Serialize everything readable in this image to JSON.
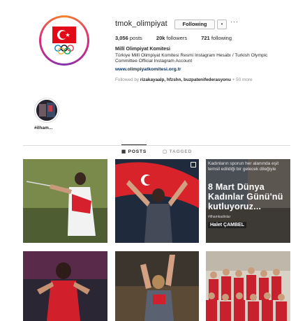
{
  "profile": {
    "username": "tmok_olimpiyat",
    "follow_label": "Following",
    "dropdown_label": "▾",
    "more_label": "···",
    "stats": [
      {
        "value": "3,056",
        "label": "posts"
      },
      {
        "value": "20k",
        "label": "followers"
      },
      {
        "value": "721",
        "label": "following"
      }
    ],
    "full_name": "Millî Olimpiyat Komitesi",
    "bio": "Türkiye Millî Olimpiyat Komitesi Resmi Instagram Hesabı / Turkish Olympic Committee Official Instagram Account",
    "link": "www.olimpiyatkomitesi.org.tr",
    "followed_prefix": "Followed by",
    "followed_names": "rizakayaalp, hfzshn, buzpatenifederasyonu",
    "followed_more": "+ 50 more"
  },
  "highlights": [
    {
      "label": "#ilham..."
    }
  ],
  "tabs": {
    "posts": "POSTS",
    "tagged": "TAGGED"
  },
  "posts": {
    "post3_small_text": "Kadınların sporun her alanında eşit temsil edildiği bir gelecek dileğiyle",
    "post3_headline": "8 Mart Dünya Kadınlar Günü'nü kutluyoruz...",
    "post3_tag": "#ilhamkadinlar",
    "post3_name": "Halet ÇAMBEL"
  },
  "colors": {
    "link": "#003569",
    "muted": "#8e8e8e",
    "text": "#262626",
    "flag_red": "#e30a17"
  }
}
